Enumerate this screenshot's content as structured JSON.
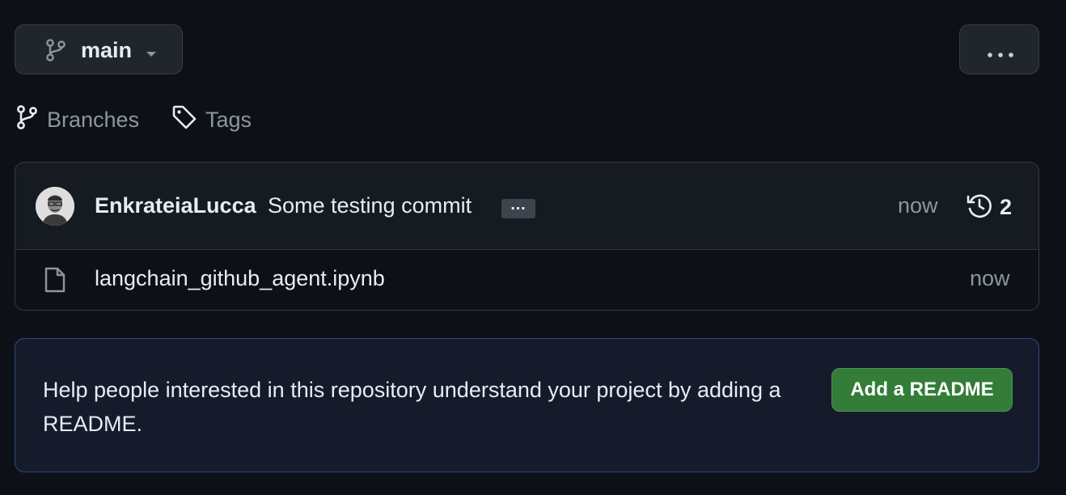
{
  "branch_selector": {
    "branch_name": "main",
    "branch_icon": "git-branch-icon",
    "caret_icon": "triangle-down-icon"
  },
  "more_menu": {
    "icon": "kebab-horizontal-icon"
  },
  "refs": {
    "branches_label": "Branches",
    "branches_icon": "git-branch-icon",
    "tags_label": "Tags",
    "tags_icon": "tag-icon"
  },
  "latest_commit": {
    "author": "EnkrateiaLucca",
    "message": "Some testing commit",
    "ellipsis": "…",
    "time": "now",
    "history_icon": "history-icon",
    "commit_count": "2"
  },
  "files": [
    {
      "name": "langchain_github_agent.ipynb",
      "time": "now",
      "icon": "file-icon"
    }
  ],
  "readme_prompt": {
    "text": "Help people interested in this repository understand your project by adding a README.",
    "button_label": "Add a README"
  },
  "colors": {
    "background": "#0d1117",
    "button_bg": "#21262d",
    "muted_text": "#8d96a0",
    "accent_green": "#347d39",
    "accent_border_blue": "#2d4a80"
  }
}
